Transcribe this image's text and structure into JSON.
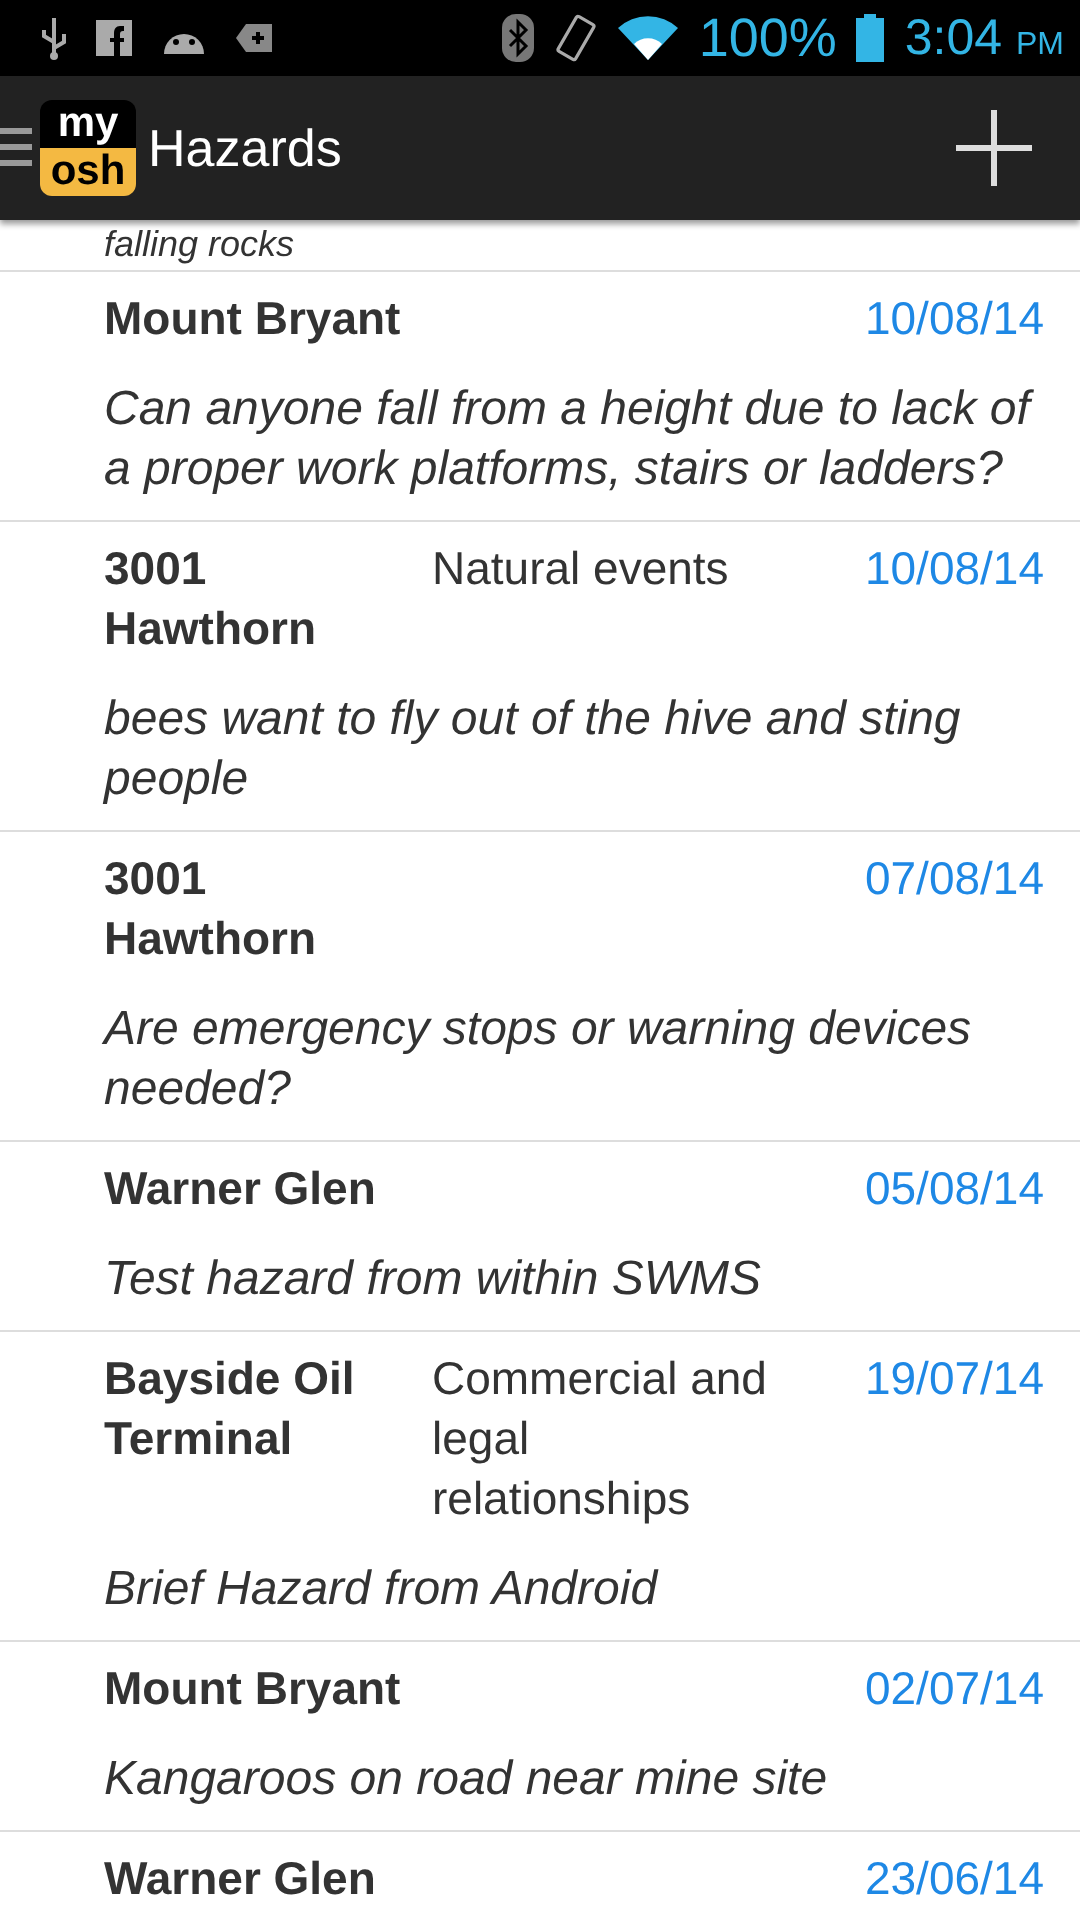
{
  "status_bar": {
    "battery": "100%",
    "time": "3:04",
    "ampm": "PM"
  },
  "app_bar": {
    "logo_top": "my",
    "logo_bottom": "osh",
    "title": "Hazards"
  },
  "partial_description": "falling rocks",
  "hazards": [
    {
      "site": "Mount Bryant",
      "date": "10/08/14",
      "description": "Can anyone fall from a height due to lack of a proper work platforms, stairs or ladders?"
    },
    {
      "site": "3001 Hawthorn",
      "category": "Natural events",
      "date": "10/08/14",
      "description": "bees want to fly out of the hive and sting people"
    },
    {
      "site": "3001 Hawthorn",
      "date": "07/08/14",
      "description": "Are emergency stops or warning devices needed?"
    },
    {
      "site": "Warner Glen",
      "date": "05/08/14",
      "description": "Test hazard from within SWMS"
    },
    {
      "site": "Bayside Oil Terminal",
      "category": "Commercial and legal relationships",
      "date": "19/07/14",
      "description": "Brief Hazard from Android"
    },
    {
      "site": "Mount Bryant",
      "date": "02/07/14",
      "description": "Kangaroos on road near mine site"
    },
    {
      "site": "Warner Glen",
      "date": "23/06/14"
    }
  ]
}
